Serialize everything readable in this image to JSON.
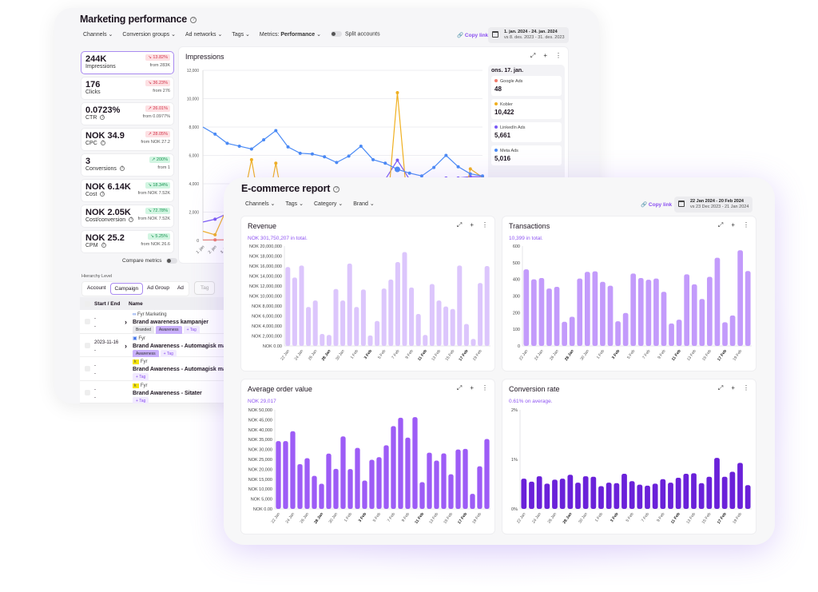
{
  "marketing": {
    "title": "Marketing performance",
    "filters": [
      "Channels",
      "Conversion groups",
      "Ad networks",
      "Tags"
    ],
    "metrics_label": "Metrics:",
    "metrics_value": "Performance",
    "split_accounts": "Split accounts",
    "copy_link": "Copy link",
    "date_range": "1. jan. 2024 - 24. jan. 2024",
    "compare_range": "vs 8. des. 2023 - 31. des. 2023",
    "kpis": [
      {
        "value": "244K",
        "label": "Impressions",
        "change": "13.82%",
        "dir": "down",
        "from": "from 283K"
      },
      {
        "value": "176",
        "label": "Clicks",
        "change": "36.23%",
        "dir": "down",
        "from": "from 276"
      },
      {
        "value": "0.0723%",
        "label": "CTR",
        "change": "26.01%",
        "dir": "down",
        "from": "from 0.0977%"
      },
      {
        "value": "NOK 34.9",
        "label": "CPC",
        "change": "28.05%",
        "dir": "down",
        "from": "from NOK 27.2"
      },
      {
        "value": "3",
        "label": "Conversions",
        "change": "200%",
        "dir": "up",
        "from": "from 1"
      },
      {
        "value": "NOK 6.14K",
        "label": "Cost",
        "change": "18.34%",
        "dir": "up",
        "from": "from NOK 7.52K"
      },
      {
        "value": "NOK 2.05K",
        "label": "Cost/conversion",
        "change": "72.78%",
        "dir": "up",
        "from": "from NOK 7.52K"
      },
      {
        "value": "NOK 25.2",
        "label": "CPM",
        "change": "5.25%",
        "dir": "up",
        "from": "from NOK 26.6"
      }
    ],
    "compare_metrics": "Compare metrics",
    "legend": {
      "date": "ons. 17. jan.",
      "items": [
        {
          "name": "Google Ads",
          "value": "48",
          "color": "#f07a6a"
        },
        {
          "name": "Kobler",
          "value": "10,422",
          "color": "#f0b020"
        },
        {
          "name": "LinkedIn Ads",
          "value": "5,661",
          "color": "#7a5af5"
        },
        {
          "name": "Meta Ads",
          "value": "5,016",
          "color": "#4a8af5"
        }
      ]
    },
    "hierarchy": {
      "label": "Hierarchy Level",
      "levels": [
        "Account",
        "Campaign",
        "Ad Group",
        "Ad"
      ],
      "selected": "Campaign",
      "tag_button": "Tag"
    },
    "table": {
      "headers": [
        "Start / End",
        "Name"
      ],
      "rows": [
        {
          "start": "-",
          "end": "-",
          "account": "Fyr Marketing",
          "name": "Brand awareness kampanjer",
          "tags": [
            "Branded",
            "Awareness"
          ],
          "add_tag": "+ Tag"
        },
        {
          "start": "2023-11-16",
          "end": "-",
          "account": "Fyr",
          "name": "Brand Awareness - Automagisk ma",
          "tags": [
            "Awareness"
          ],
          "add_tag": "+ Tag"
        },
        {
          "start": "-",
          "end": "-",
          "account": "Fyr",
          "name": "Brand Awareness - Automagisk ma",
          "tags": [],
          "add_tag": "+ Tag"
        },
        {
          "start": "-",
          "end": "-",
          "account": "Fyr",
          "name": "Brand Awareness - Sitater",
          "tags": [],
          "add_tag": "+ Tag"
        }
      ]
    }
  },
  "ecommerce": {
    "title": "E-commerce report",
    "filters": [
      "Channels",
      "Tags",
      "Category",
      "Brand"
    ],
    "copy_link": "Copy link",
    "date_range": "22 Jan 2024 - 20 Feb 2024",
    "compare_range": "vs 23 Dec 2023 - 21 Jan 2024",
    "panels": [
      {
        "title": "Revenue",
        "summary": "NOK 301,750,207 in total."
      },
      {
        "title": "Transactions",
        "summary": "10,399 in total."
      },
      {
        "title": "Average order value",
        "summary": "NOK 29,017"
      },
      {
        "title": "Conversion rate",
        "summary": "0.61% on average."
      }
    ]
  },
  "chart_data": [
    {
      "type": "line",
      "title": "Impressions",
      "x": [
        "1. jan",
        "2. jan",
        "3. jan",
        "4. jan",
        "5. jan",
        "6. jan",
        "7. jan",
        "8. jan",
        "9. jan",
        "10. jan",
        "11. jan",
        "12. jan",
        "13. jan",
        "14. jan",
        "15. jan",
        "16. jan",
        "17. jan",
        "18. jan",
        "19. jan",
        "20. jan",
        "21. jan",
        "22. jan",
        "23. jan",
        "24. jan"
      ],
      "xtick_labels": [
        "1. jan",
        "2. jan",
        "3. jan"
      ],
      "ylim": [
        0,
        12000
      ],
      "yticks": [
        "0",
        "2,000",
        "4,000",
        "6,000",
        "8,000",
        "10,000",
        "12,000"
      ],
      "grid": true,
      "series": [
        {
          "name": "Meta Ads",
          "color": "#4a8af5",
          "values": [
            8000,
            7500,
            6850,
            6650,
            6450,
            7100,
            7750,
            6600,
            6150,
            6100,
            5900,
            5500,
            5950,
            6650,
            5700,
            5450,
            5016,
            4750,
            4550,
            5150,
            6000,
            5200,
            4700,
            4550
          ]
        },
        {
          "name": "Kobler",
          "color": "#f0b020",
          "values": [
            650,
            400,
            2300,
            1500,
            5700,
            900,
            5450,
            800,
            700,
            600,
            500,
            800,
            600,
            700,
            500,
            400,
            10422,
            900,
            700,
            600,
            500,
            800,
            5050,
            4450
          ]
        },
        {
          "name": "LinkedIn Ads",
          "color": "#7a5af5",
          "values": [
            1300,
            1500,
            1900,
            2100,
            2300,
            2500,
            2700,
            2900,
            3100,
            3300,
            3500,
            3700,
            3800,
            3900,
            4000,
            4300,
            5661,
            4300,
            4300,
            4300,
            4400,
            4400,
            4500,
            4500
          ]
        },
        {
          "name": "Google Ads",
          "color": "#f07a6a",
          "values": [
            40,
            45,
            50,
            45,
            40,
            40,
            45,
            50,
            48,
            40,
            45,
            50,
            45,
            40,
            45,
            50,
            48,
            45,
            40,
            45,
            50,
            45,
            40,
            45
          ]
        }
      ]
    },
    {
      "type": "bar",
      "title": "Revenue",
      "color": "#dcc6fc",
      "ylim": [
        0,
        20000000
      ],
      "yticks": [
        "NOK 0.00",
        "NOK 2,000,000",
        "NOK 4,000,000",
        "NOK 6,000,000",
        "NOK 8,000,000",
        "NOK 10,000,000",
        "NOK 12,000,000",
        "NOK 14,000,000",
        "NOK 16,000,000",
        "NOK 18,000,000",
        "NOK 20,000,000"
      ],
      "values": [
        15800000,
        13700000,
        16100000,
        7800000,
        9100000,
        2400000,
        2200000,
        11400000,
        9100000,
        16500000,
        7800000,
        11300000,
        2100000,
        5000000,
        11500000,
        13300000,
        16800000,
        18800000,
        11700000,
        6400000,
        2200000,
        12400000,
        9100000,
        7900000,
        7400000,
        16100000,
        4400000,
        1400000,
        12600000,
        16000000
      ]
    },
    {
      "type": "bar",
      "title": "Transactions",
      "color": "#c39bfb",
      "ylim": [
        0,
        600
      ],
      "yticks": [
        "0",
        "100",
        "200",
        "300",
        "400",
        "500",
        "600"
      ],
      "values": [
        460,
        400,
        408,
        345,
        355,
        145,
        175,
        405,
        445,
        448,
        385,
        362,
        148,
        198,
        435,
        408,
        398,
        405,
        325,
        135,
        158,
        430,
        370,
        282,
        415,
        530,
        142,
        183,
        575,
        450
      ]
    },
    {
      "type": "bar",
      "title": "Average order value",
      "color": "#9d5cf6",
      "ylim": [
        0,
        50000
      ],
      "yticks": [
        "NOK 0.00",
        "NOK 5,000",
        "NOK 10,000",
        "NOK 15,000",
        "NOK 20,000",
        "NOK 25,000",
        "NOK 30,000",
        "NOK 35,000",
        "NOK 40,000",
        "NOK 45,000",
        "NOK 50,000"
      ],
      "values": [
        34200,
        34200,
        39200,
        22600,
        25600,
        16700,
        12700,
        27900,
        20200,
        36600,
        20100,
        30800,
        14300,
        24800,
        26100,
        32100,
        41800,
        46000,
        36000,
        46300,
        13500,
        28400,
        24400,
        28000,
        17500,
        30000,
        30300,
        7600,
        21500,
        35300
      ]
    },
    {
      "type": "bar",
      "title": "Conversion rate",
      "color": "#6a21d9",
      "ylim": [
        0,
        2
      ],
      "yticks": [
        "0%",
        "1%",
        "2%"
      ],
      "values": [
        0.61,
        0.55,
        0.66,
        0.51,
        0.59,
        0.61,
        0.69,
        0.53,
        0.66,
        0.65,
        0.46,
        0.53,
        0.52,
        0.71,
        0.56,
        0.49,
        0.47,
        0.51,
        0.6,
        0.53,
        0.63,
        0.71,
        0.72,
        0.52,
        0.65,
        1.03,
        0.65,
        0.75,
        0.93,
        0.48
      ]
    }
  ],
  "bar_xticks": {
    "labels": [
      "22 Jan",
      "24 Jan",
      "26 Jan",
      "28 Jan",
      "30 Jan",
      "1 Feb",
      "3 Feb",
      "5 Feb",
      "7 Feb",
      "9 Feb",
      "11 Feb",
      "13 Feb",
      "15 Feb",
      "17 Feb",
      "19 Feb"
    ],
    "bold": [
      "28 Jan",
      "3 Feb",
      "11 Feb",
      "17 Feb"
    ]
  }
}
